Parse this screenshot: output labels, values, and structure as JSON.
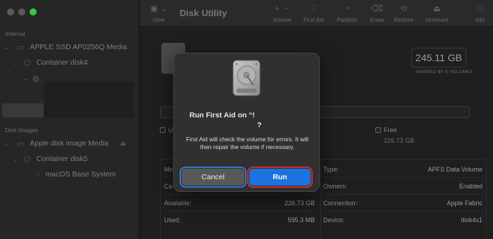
{
  "window": {
    "title": "Disk Utility"
  },
  "toolbar": {
    "view": "View",
    "volume": "Volume",
    "first_aid": "First Aid",
    "partition": "Partition",
    "erase": "Erase",
    "restore": "Restore",
    "unmount": "Unmount",
    "info": "Info"
  },
  "sidebar": {
    "internal_header": "Internal",
    "disk_images_header": "Disk Images",
    "items": [
      {
        "label": "APPLE SSD AP0256Q Media",
        "icon": "internal-disk-icon"
      },
      {
        "label": "Container disk4",
        "icon": "container-icon"
      },
      {
        "label": "Apple disk image Media",
        "icon": "disk-image-icon"
      },
      {
        "label": "Container disk5",
        "icon": "container-icon"
      },
      {
        "label": "macOS Base System",
        "icon": "volume-icon"
      }
    ]
  },
  "main": {
    "capacity": "245.11 GB",
    "capacity_caption": "SHARED BY 5 VOLUMES",
    "legend": [
      {
        "label": "U",
        "value": ""
      },
      {
        "label": "Free",
        "value": "226.73 GB"
      }
    ],
    "info": {
      "left": [
        {
          "key": "Mo",
          "value": ""
        },
        {
          "key": "Ca",
          "value": ""
        },
        {
          "key": "Available:",
          "value": "226.73 GB"
        },
        {
          "key": "Used:",
          "value": "595.3 MB"
        }
      ],
      "right": [
        {
          "key": "Type:",
          "value": "APFS Data Volume"
        },
        {
          "key": "Owners:",
          "value": "Enabled"
        },
        {
          "key": "Connection:",
          "value": "Apple Fabric"
        },
        {
          "key": "Device:",
          "value": "disk4s1"
        }
      ]
    }
  },
  "dialog": {
    "title": "Run First Aid on “!",
    "title_cont": "?",
    "message": "First Aid will check the volume for errors. It will then repair the volume if necessary.",
    "cancel": "Cancel",
    "run": "Run"
  },
  "colors": {
    "accent": "#1a73de",
    "highlight_red": "#d32c2c",
    "focus_blue": "#2e7bd2",
    "traffic_green": "#34c84a"
  }
}
